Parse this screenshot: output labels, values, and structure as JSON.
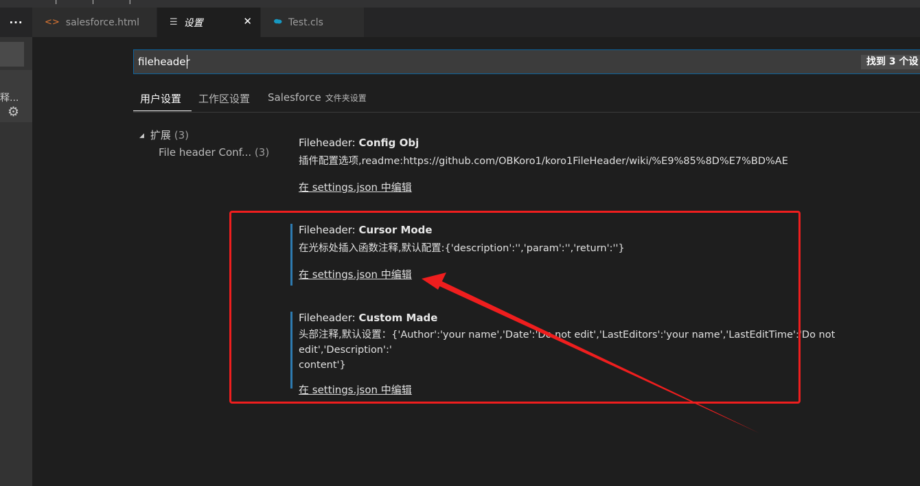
{
  "tabs": [
    {
      "label": "salesforce.html",
      "icon": "code-brackets-icon",
      "active": false
    },
    {
      "label": "设置",
      "icon": "settings-list-icon",
      "active": true,
      "close": "✕"
    },
    {
      "label": "Test.cls",
      "icon": "salesforce-cloud-icon",
      "active": false
    }
  ],
  "more_label": "···",
  "sidebar": {
    "item_label": "释...",
    "gear": "gear-icon"
  },
  "search": {
    "value": "fileheader",
    "result_badge": "找到 3 个设"
  },
  "scopes": {
    "user": "用户设置",
    "workspace": "工作区设置",
    "folder": "Salesforce",
    "folder_suffix": "文件夹设置"
  },
  "toc": {
    "group_label": "扩展",
    "group_count": "(3)",
    "item_label": "File header Conf...",
    "item_count": "(3)"
  },
  "settings": [
    {
      "category": "Fileheader: ",
      "name": "Config Obj",
      "description": "插件配置选项,readme:https://github.com/OBKoro1/koro1FileHeader/wiki/%E9%85%8D%E7%BD%AE",
      "link": "在 settings.json 中编辑"
    },
    {
      "category": "Fileheader: ",
      "name": "Cursor Mode",
      "description": "在光标处插入函数注释,默认配置:{'description':'','param':'','return':''}",
      "link": "在 settings.json 中编辑"
    },
    {
      "category": "Fileheader: ",
      "name": "Custom Made",
      "description": "头部注释,默认设置：{'Author':'your name','Date':'Do not edit','LastEditors':'your name','LastEditTime':'Do not edit','Description':'\ncontent'}",
      "link": "在 settings.json 中编辑"
    }
  ],
  "colors": {
    "annotation": "#ef1e1e",
    "accent": "#0e639c",
    "focus_bar": "#2e7bb0"
  }
}
